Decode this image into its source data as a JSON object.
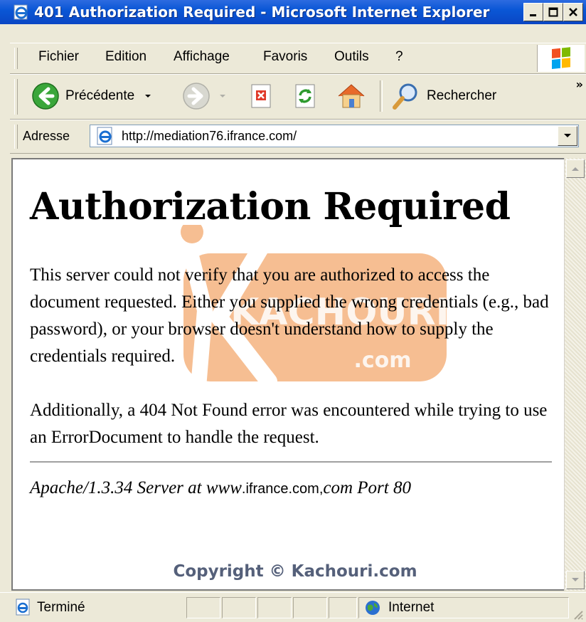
{
  "window": {
    "title": "401 Authorization Required - Microsoft Internet Explorer"
  },
  "menubar": {
    "items": [
      "Fichier",
      "Edition",
      "Affichage",
      "Favoris",
      "Outils",
      "?"
    ]
  },
  "toolbar": {
    "back_label": "Précédente",
    "search_label": "Rechercher",
    "more": "»"
  },
  "address": {
    "label": "Adresse",
    "url": "http://mediation76.ifrance.com/"
  },
  "page": {
    "heading": "Authorization Required",
    "paragraph1": "This server could not verify that you are authorized to access the document requested. Either you supplied the wrong credentials (e.g., bad password), or your browser doesn't understand how to supply the credentials required.",
    "paragraph2": "Additionally, a 404 Not Found error was encountered while trying to use an ErrorDocument to handle the request.",
    "signature_prefix": "Apache/1.3.34 Server at www",
    "signature_host": ".ifrance.com,",
    "signature_suffix": "com Port 80"
  },
  "watermark": {
    "text": "KACHOURI",
    "sub": ".com"
  },
  "copyright": "Copyright © Kachouri.com",
  "status": {
    "left": "Terminé",
    "zone": "Internet"
  },
  "colors": {
    "titlebar": "#0a57d6",
    "chrome": "#ece9d8",
    "watermark": "#f08a3a",
    "copyright": "#55607a"
  }
}
